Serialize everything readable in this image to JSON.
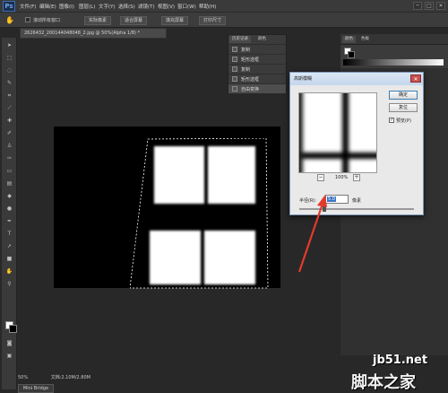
{
  "app": {
    "logo": "Ps"
  },
  "menu": [
    "文件(F)",
    "编辑(E)",
    "图像(I)",
    "图层(L)",
    "文字(Y)",
    "选择(S)",
    "滤镜(T)",
    "视图(V)",
    "窗口(W)",
    "帮助(H)"
  ],
  "window_buttons": [
    "─",
    "□",
    "✕"
  ],
  "options_bar": {
    "checkbox_label": "滚动所有窗口",
    "buttons": [
      "实际像素",
      "适合屏幕",
      "填充屏幕",
      "打印尺寸"
    ]
  },
  "document": {
    "tab_title": "2626432_200144048048_2.jpg @ 50%(Alpha 1/8) *",
    "status_zoom": "50%",
    "status_doc": "文档:2.10M/2.80M",
    "mini_bridge": "Mini Bridge"
  },
  "history_panel": {
    "tabs": [
      "历史记录",
      "颜色"
    ],
    "items": [
      "复制",
      "矩形选框",
      "复制",
      "矩形选框",
      "自由变换"
    ],
    "active_index": 4
  },
  "dialog": {
    "title": "高斯模糊",
    "close": "✕",
    "ok": "确定",
    "reset": "复位",
    "preview_label": "预览(P)",
    "preview_checked": true,
    "zoom_out": "−",
    "zoom_in": "+",
    "zoom_value": "100%",
    "radius_label": "半径(R):",
    "radius_value": "5.0",
    "radius_unit": "像素"
  },
  "right_panel": {
    "tabs": [
      "颜色",
      "色板"
    ]
  },
  "watermark": {
    "site": "jb51.net",
    "text": "脚本之家"
  },
  "colors": {
    "accent": "#3a74c6",
    "arrow": "#e23b2e"
  }
}
